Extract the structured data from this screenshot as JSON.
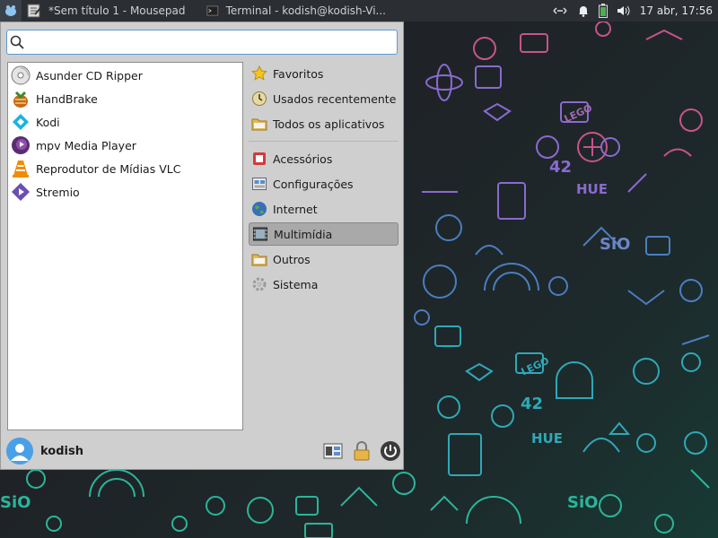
{
  "panel": {
    "tasks": [
      {
        "label": "*Sem título 1 - Mousepad",
        "icon": "mousepad-icon"
      },
      {
        "label": "Terminal - kodish@kodish-Vi...",
        "icon": "terminal-icon"
      }
    ],
    "clock": "17 abr, 17:56"
  },
  "search": {
    "value": "",
    "placeholder": ""
  },
  "apps": [
    {
      "label": "Asunder CD Ripper",
      "icon": "cd-ripper-icon"
    },
    {
      "label": "HandBrake",
      "icon": "handbrake-icon"
    },
    {
      "label": "Kodi",
      "icon": "kodi-icon"
    },
    {
      "label": "mpv Media Player",
      "icon": "mpv-icon"
    },
    {
      "label": "Reprodutor de Mídias VLC",
      "icon": "vlc-icon"
    },
    {
      "label": "Stremio",
      "icon": "stremio-icon"
    }
  ],
  "categories_top": [
    {
      "label": "Favoritos",
      "icon": "star-icon"
    },
    {
      "label": "Usados recentemente",
      "icon": "clock-icon"
    },
    {
      "label": "Todos os aplicativos",
      "icon": "folder-icon"
    }
  ],
  "categories": [
    {
      "label": "Acessórios",
      "icon": "accessories-icon",
      "selected": false
    },
    {
      "label": "Configurações",
      "icon": "settings-icon",
      "selected": false
    },
    {
      "label": "Internet",
      "icon": "globe-icon",
      "selected": false
    },
    {
      "label": "Multimídia",
      "icon": "multimedia-icon",
      "selected": true
    },
    {
      "label": "Outros",
      "icon": "folder-icon",
      "selected": false
    },
    {
      "label": "Sistema",
      "icon": "system-gear-icon",
      "selected": false
    }
  ],
  "user": {
    "name": "kodish"
  },
  "wallpaper_text": {
    "sio2": "SiO",
    "hue": "HUE",
    "lego": "LEGO",
    "n42": "42"
  },
  "colors": {
    "accent": "#5b9bd5",
    "selected": "#a9a9a9",
    "wallpaper_cyan": "#3ab0c8",
    "wallpaper_pink": "#d05a8a"
  }
}
